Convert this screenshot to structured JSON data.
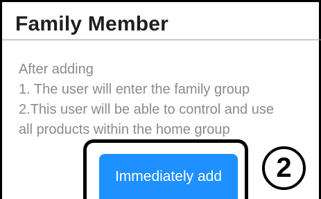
{
  "dialog": {
    "title": "Family Member",
    "lines": [
      "After adding",
      "1. The user will enter the family group",
      "2.This user will be able to control and use",
      "all products within the home group"
    ],
    "add_button_label": "Immediately add",
    "step_marker": "2"
  }
}
